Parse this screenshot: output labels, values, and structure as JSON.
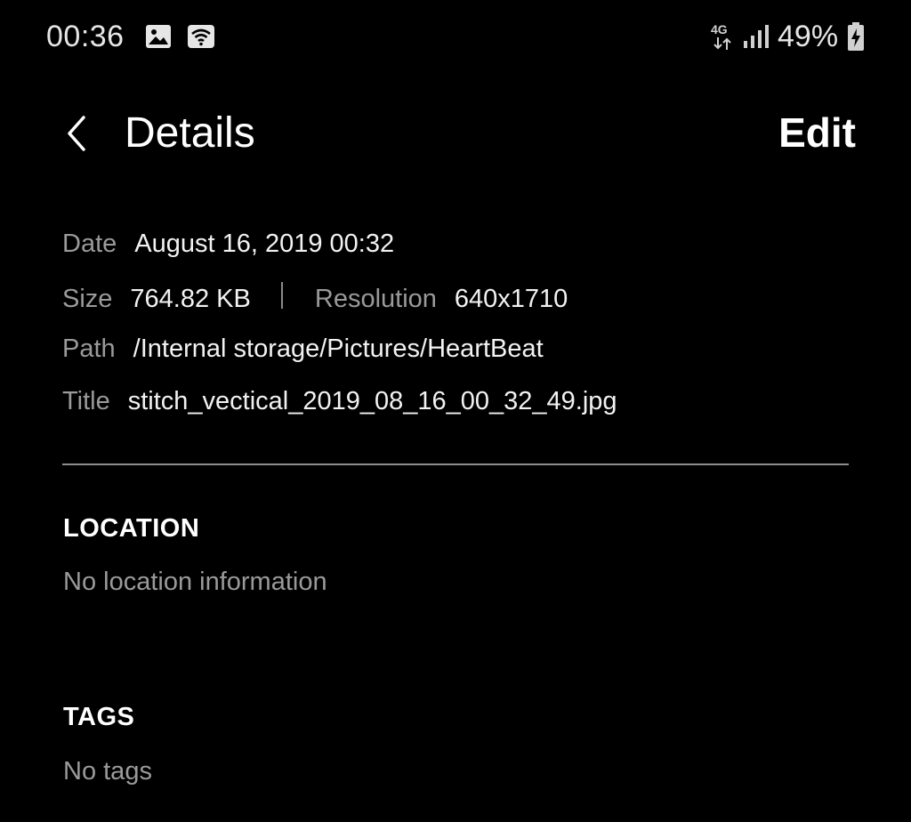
{
  "status_bar": {
    "time": "00:36",
    "network_type": "4G",
    "battery_percent": "49%",
    "icons": [
      "image-notification-icon",
      "wifi-icon",
      "4g-data-icon",
      "signal-strength-icon",
      "battery-charging-icon"
    ]
  },
  "app_bar": {
    "back_icon": "chevron-left-icon",
    "title": "Details",
    "edit_label": "Edit"
  },
  "details": {
    "date_label": "Date",
    "date_value": "August 16, 2019 00:32",
    "size_label": "Size",
    "size_value": "764.82 KB",
    "resolution_label": "Resolution",
    "resolution_value": "640x1710",
    "path_label": "Path",
    "path_value": "/Internal storage/Pictures/HeartBeat",
    "title_label": "Title",
    "title_value": "stitch_vectical_2019_08_16_00_32_49.jpg"
  },
  "location": {
    "heading": "LOCATION",
    "text": "No location information"
  },
  "tags": {
    "heading": "TAGS",
    "text": "No tags"
  },
  "colors": {
    "background": "#000000",
    "primary_text": "#ffffff",
    "secondary_text": "#9a9a9a",
    "divider": "#8c8c8c"
  }
}
